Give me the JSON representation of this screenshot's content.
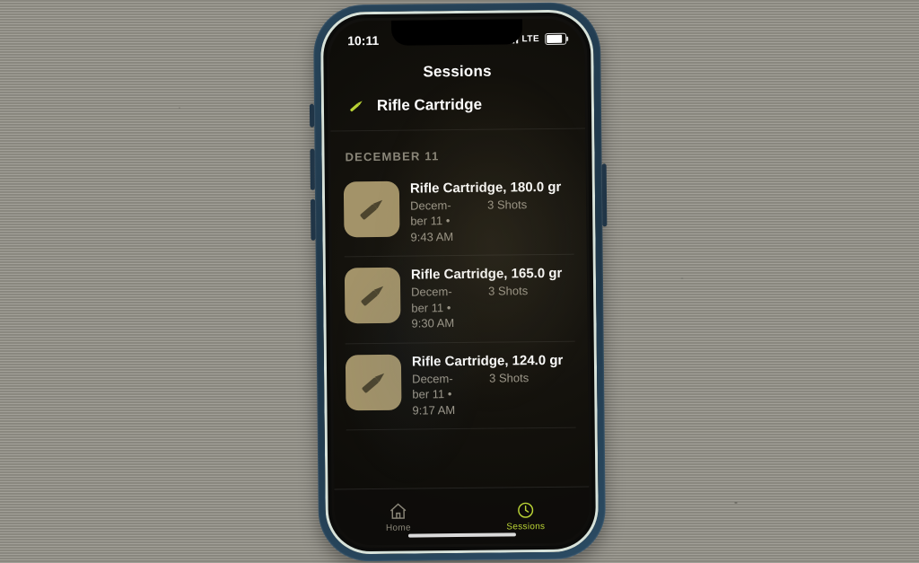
{
  "status": {
    "time": "10:11",
    "carrier_style": "bars",
    "network_label": "LTE",
    "battery_pct": 90
  },
  "nav": {
    "title": "Sessions"
  },
  "profile": {
    "icon_name": "cartridge-icon",
    "label": "Rifle Cartridge",
    "accent": "#b9d235"
  },
  "date_header": "DECEMBER 11",
  "sessions": [
    {
      "title": "Rifle Cartridge, 180.0 gr",
      "when_lines": [
        "Decem-",
        "ber 11 •",
        "9:43 AM"
      ],
      "shots": "3 Shots"
    },
    {
      "title": "Rifle Cartridge, 165.0 gr",
      "when_lines": [
        "Decem-",
        "ber 11 •",
        "9:30 AM"
      ],
      "shots": "3 Shots"
    },
    {
      "title": "Rifle Cartridge, 124.0 gr",
      "when_lines": [
        "Decem-",
        "ber 11 •",
        "9:17 AM"
      ],
      "shots": "3 Shots"
    }
  ],
  "tabs": {
    "home": {
      "label": "Home",
      "active": false
    },
    "sessions": {
      "label": "Sessions",
      "active": true
    }
  },
  "colors": {
    "accent": "#b9d235",
    "thumb_bg": "#a39369"
  }
}
